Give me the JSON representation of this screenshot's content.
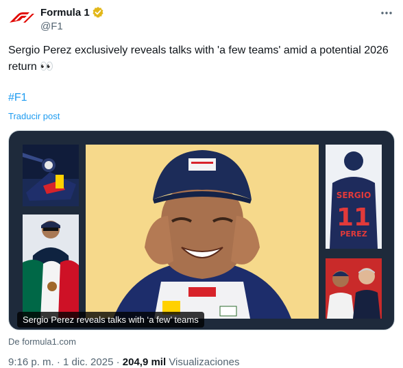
{
  "tweet": {
    "display_name": "Formula 1",
    "handle": "@F1",
    "text": "Sergio Perez exclusively reveals talks with 'a few teams' amid a potential 2026 return 👀",
    "hashtag": "#F1",
    "translate_label": "Traducir post",
    "media_caption": "Sergio Perez reveals talks with ‘a few’ teams",
    "source": "De formula1.com",
    "meta_partial": "9:16 p. m. · 1 dic. 2025 · ",
    "views_partial": "204,9 mil",
    "views_label_partial": " Visualizaciones"
  },
  "icons": {
    "avatar": "f1-logo-icon",
    "verified": "gold-verified-badge-icon",
    "more": "more-options-icon"
  },
  "colors": {
    "f1_red": "#e10600",
    "link_blue": "#1d9bf0",
    "verified_gold": "#e2b719",
    "secondary_text": "#536471"
  }
}
